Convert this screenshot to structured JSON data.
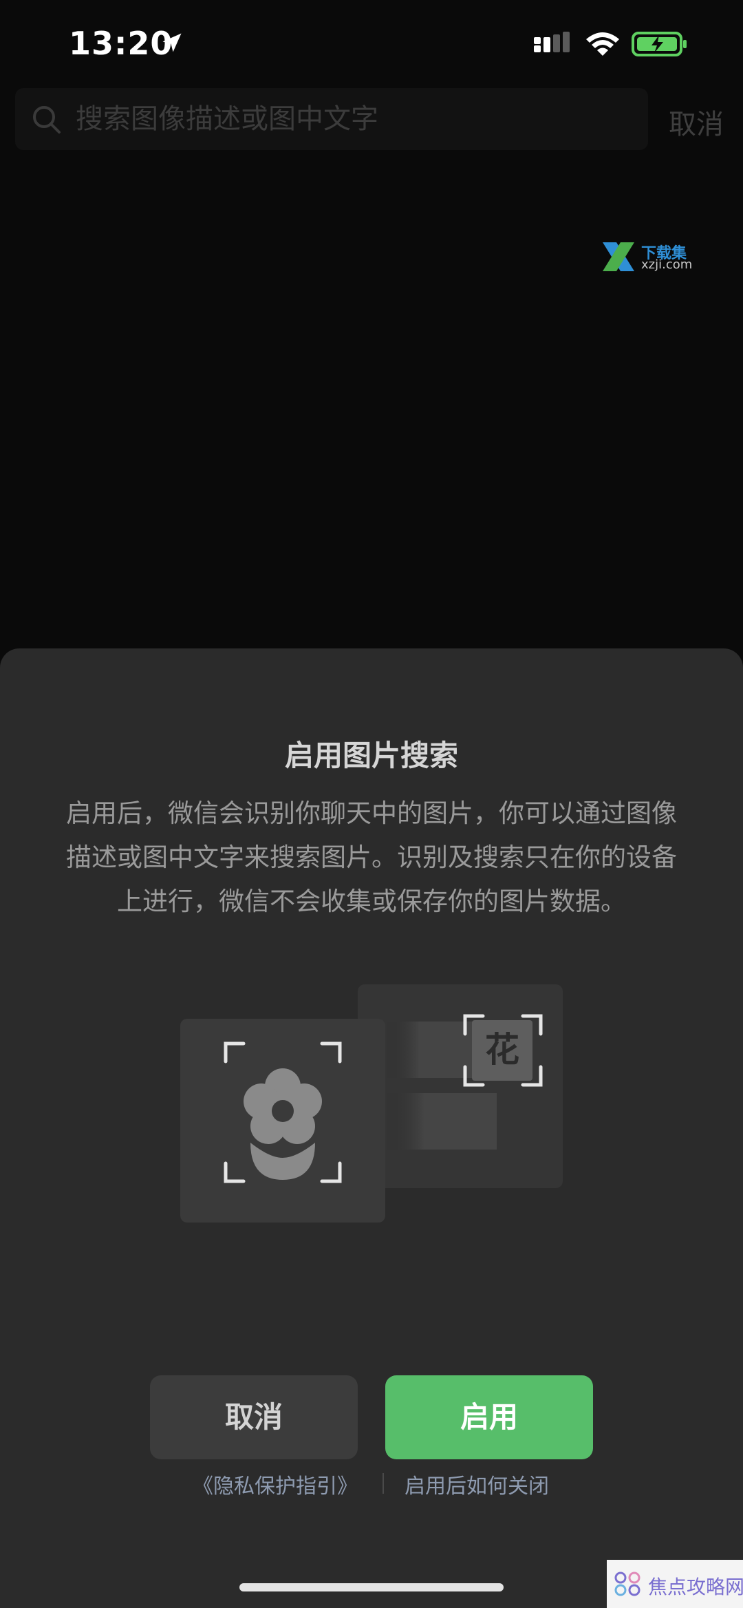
{
  "status_bar": {
    "time": "13:20"
  },
  "search": {
    "placeholder": "搜索图像描述或图中文字",
    "cancel_label": "取消"
  },
  "watermark_top": {
    "title": "下载集",
    "subtitle": "xzji.com"
  },
  "sheet": {
    "title": "启用图片搜索",
    "description": "启用后，微信会识别你聊天中的图片，你可以通过图像描述或图中文字来搜索图片。识别及搜索只在你的设备上进行，微信不会收集或保存你的图片数据。",
    "illustration_char": "花",
    "cancel_button": "取消",
    "enable_button": "启用",
    "privacy_link": "《隐私保护指引》",
    "how_to_close_link": "启用后如何关闭"
  },
  "watermark_bottom": {
    "text": "焦点攻略网"
  },
  "colors": {
    "background": "#0a0a0a",
    "sheet": "#2b2b2b",
    "accent_green": "#57be6a",
    "battery_green": "#5fd161",
    "link": "#8e9bb0"
  },
  "icons": {
    "location": "location-arrow-icon",
    "signal": "cellular-signal-icon",
    "wifi": "wifi-icon",
    "battery": "battery-charging-icon",
    "search": "search-icon",
    "flower": "flower-icon"
  }
}
